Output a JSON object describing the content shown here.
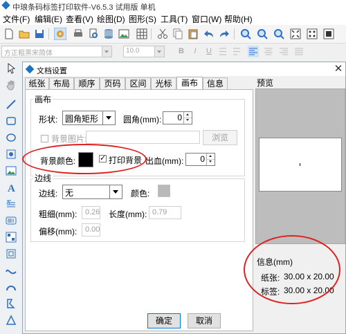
{
  "window": {
    "title": "中琅条码标签打印软件-V6.5.3 试用版 单机"
  },
  "menu": [
    "文件(F)",
    "编辑(E)",
    "查看(V)",
    "绘图(D)",
    "图形(S)",
    "工具(T)",
    "窗口(W)",
    "帮助(H)"
  ],
  "format_bar": {
    "font": "方正粗黑宋简体",
    "size": "10.0",
    "bold": "B",
    "italic": "I",
    "underline": "U"
  },
  "dialog": {
    "title": "文档设置",
    "tabs": [
      "纸张",
      "布局",
      "顺序",
      "页码",
      "区间",
      "光标",
      "画布",
      "信息"
    ],
    "active_tab": "画布",
    "canvas_group": {
      "title": "画布",
      "shape_label": "形状:",
      "shape_value": "圆角矩形",
      "radius_label": "圆角(mm):",
      "radius_value": "0",
      "bg_image_label": "背景图片:",
      "browse_label": "浏览",
      "bg_color_label": "背景颜色:",
      "bg_color": "#000000",
      "print_bg_label": "打印背景",
      "bleed_label": "出血(mm):",
      "bleed_value": "0"
    },
    "border_group": {
      "title": "边线",
      "border_label": "边线:",
      "border_value": "无",
      "color_label": "颜色:",
      "color_value": "#b9b9b9",
      "thickness_label": "粗细(mm):",
      "thickness_value": "0.26",
      "length_label": "长度(mm):",
      "length_value": "0.79",
      "offset_label": "偏移(mm):",
      "offset_value": "0.00"
    },
    "preview_label": "预览",
    "info": {
      "title": "信息(mm)",
      "paper_label": "纸张:",
      "paper_value": "30.00 x 20.00",
      "label_label": "标签:",
      "label_value": "30.00 x 20.00"
    },
    "ok_label": "确定",
    "cancel_label": "取消"
  },
  "annotation_color": "#e02020"
}
